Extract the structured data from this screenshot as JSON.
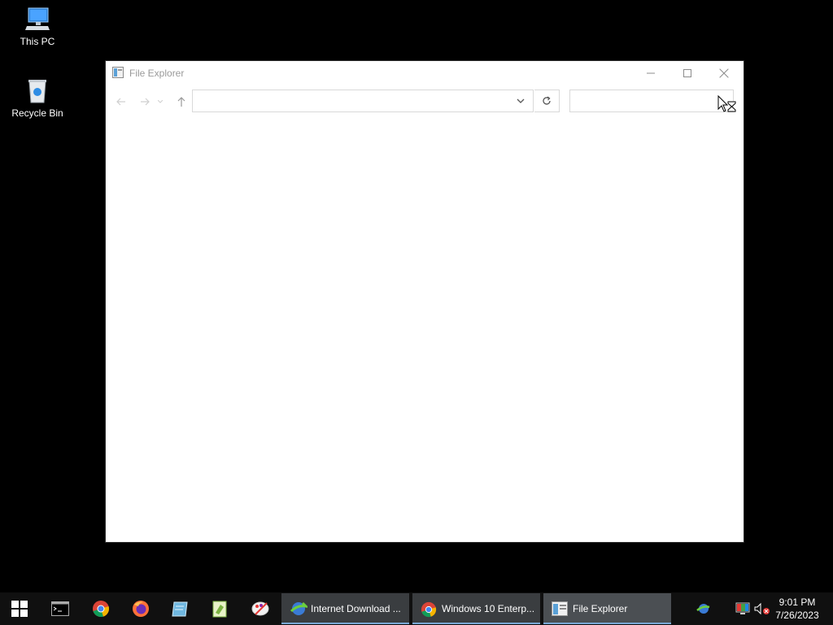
{
  "desktop": {
    "icons": [
      {
        "label": "This PC",
        "icon": "computer-icon"
      },
      {
        "label": "Recycle Bin",
        "icon": "recycle-bin-icon"
      }
    ]
  },
  "window": {
    "title": "File Explorer",
    "address_value": "",
    "search_value": ""
  },
  "taskbar": {
    "pinned": [
      "windows-start",
      "terminal",
      "chrome",
      "firefox",
      "notepad",
      "editor",
      "paint"
    ],
    "buttons": [
      {
        "label": "Internet Download ...",
        "icon": "idm-icon"
      },
      {
        "label": "Windows 10 Enterp...",
        "icon": "chrome-icon"
      },
      {
        "label": "File Explorer",
        "icon": "explorer-icon"
      }
    ],
    "clock": {
      "time": "9:01 PM",
      "date": "7/26/2023"
    }
  },
  "colors": {
    "accent": "#7aa9d6",
    "taskbar": "#101010",
    "desktop": "#000000"
  }
}
